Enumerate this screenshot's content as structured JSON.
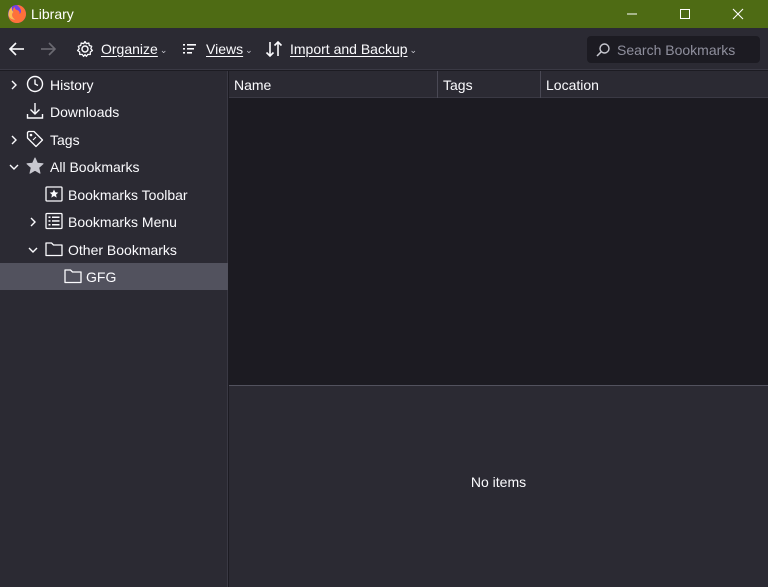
{
  "window": {
    "title": "Library",
    "title_bar_color": "#4e6b14"
  },
  "toolbar": {
    "back_icon": "back-arrow-icon",
    "forward_icon": "forward-arrow-icon",
    "organize_label": "Organize",
    "views_label": "Views",
    "import_backup_label": "Import and Backup",
    "search_placeholder": "Search Bookmarks",
    "search_value": ""
  },
  "sidebar": {
    "items": [
      {
        "label": "History",
        "icon": "clock-icon",
        "expandable": true,
        "expanded": false
      },
      {
        "label": "Downloads",
        "icon": "download-icon",
        "expandable": false
      },
      {
        "label": "Tags",
        "icon": "tag-icon",
        "expandable": true,
        "expanded": false
      },
      {
        "label": "All Bookmarks",
        "icon": "star-icon",
        "expandable": true,
        "expanded": true
      },
      {
        "label": "Bookmarks Toolbar",
        "icon": "bookmarks-toolbar-icon",
        "expandable": false
      },
      {
        "label": "Bookmarks Menu",
        "icon": "bookmarks-menu-icon",
        "expandable": true,
        "expanded": false
      },
      {
        "label": "Other Bookmarks",
        "icon": "folder-icon",
        "expandable": true,
        "expanded": true
      },
      {
        "label": "GFG",
        "icon": "folder-icon",
        "expandable": false,
        "selected": true
      }
    ]
  },
  "list": {
    "columns": [
      "Name",
      "Tags",
      "Location"
    ]
  },
  "details": {
    "empty_text": "No items"
  },
  "colors": {
    "toolbar_bg": "#2b2a33",
    "content_bg": "#1c1b22",
    "selected_row_bg": "#52525e",
    "text": "#fbfbfe"
  }
}
